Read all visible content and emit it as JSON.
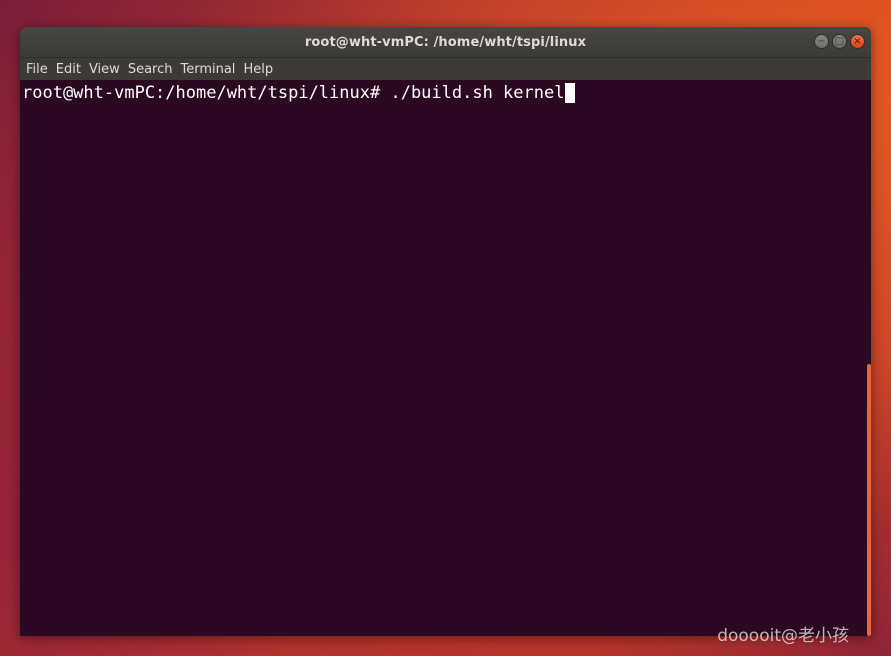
{
  "window": {
    "title": "root@wht-vmPC: /home/wht/tspi/linux",
    "controls": {
      "minimize_icon": "−",
      "maximize_icon": "□",
      "close_icon": "×"
    }
  },
  "menubar": {
    "items": [
      {
        "label": "File"
      },
      {
        "label": "Edit"
      },
      {
        "label": "View"
      },
      {
        "label": "Search"
      },
      {
        "label": "Terminal"
      },
      {
        "label": "Help"
      }
    ]
  },
  "terminal": {
    "prompt": "root@wht-vmPC:/home/wht/tspi/linux#",
    "command": " ./build.sh kernel"
  },
  "colors": {
    "terminal_bg": "#2c0922",
    "titlebar_bg": "#3c3b37",
    "scroll_thumb": "#e9683a",
    "text": "#ffffff"
  },
  "watermark": "dooooit@老小孩"
}
